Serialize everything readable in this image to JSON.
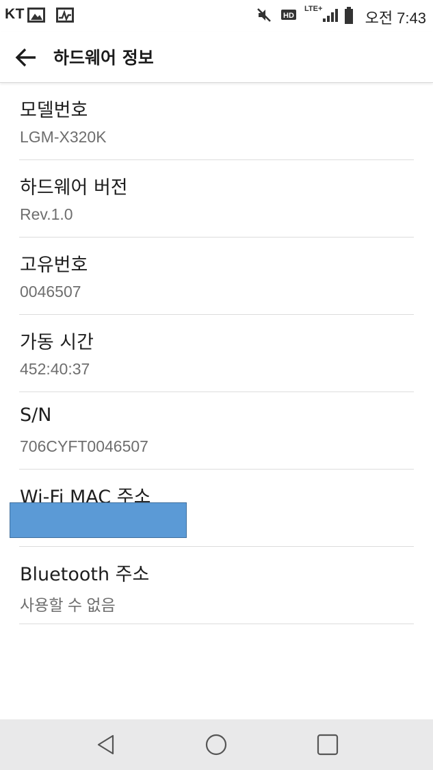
{
  "status_bar": {
    "carrier": "KT",
    "network_label": "LTE+",
    "time": "오전 7:43",
    "icons": [
      "image-icon",
      "activity-icon",
      "mute-icon",
      "hd-voice-icon",
      "lte-icon",
      "signal-icon",
      "battery-icon"
    ]
  },
  "app_bar": {
    "title": "하드웨어 정보",
    "back_icon": "arrow-left-icon"
  },
  "items": [
    {
      "label": "모델번호",
      "value": "LGM-X320K"
    },
    {
      "label": "하드웨어 버전",
      "value": "Rev.1.0"
    },
    {
      "label": "고유번호",
      "value": "0046507"
    },
    {
      "label": "가동 시간",
      "value": "452:40:37"
    },
    {
      "label": "S/N",
      "value": "706CYFT0046507"
    },
    {
      "label": "Wi-Fi MAC 주소",
      "value": ""
    },
    {
      "label": "Bluetooth 주소",
      "value": "사용할 수 없음"
    }
  ],
  "colors": {
    "redaction": "#5b9ad6",
    "nav_bar": "#e9e9ea",
    "secondary_text": "#6e6e6e"
  },
  "nav_bar": {
    "icons": [
      "back-triangle-icon",
      "home-circle-icon",
      "recents-square-icon"
    ]
  }
}
